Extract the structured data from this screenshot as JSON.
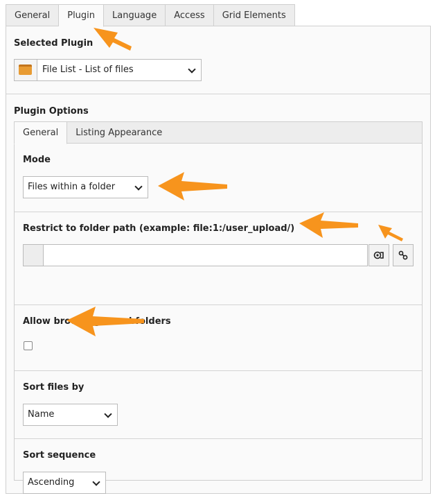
{
  "tabs": [
    "General",
    "Plugin",
    "Language",
    "Access",
    "Grid Elements"
  ],
  "selected_plugin": {
    "title": "Selected Plugin",
    "value": "File List - List of files"
  },
  "plugin_options": {
    "title": "Plugin Options",
    "tabs": [
      "General",
      "Listing Appearance"
    ]
  },
  "fields": {
    "mode": {
      "label": "Mode",
      "value": "Files within a folder"
    },
    "folder_path": {
      "label": "Restrict to folder path (example: file:1:/user_upload/)",
      "value": ""
    },
    "browse_subfolders": {
      "label": "Allow browsing to subfolders",
      "checked": false
    },
    "sort_by": {
      "label": "Sort files by",
      "value": "Name"
    },
    "sort_sequence": {
      "label": "Sort sequence",
      "value": "Ascending"
    }
  },
  "colors": {
    "arrow": "#f7941d"
  }
}
